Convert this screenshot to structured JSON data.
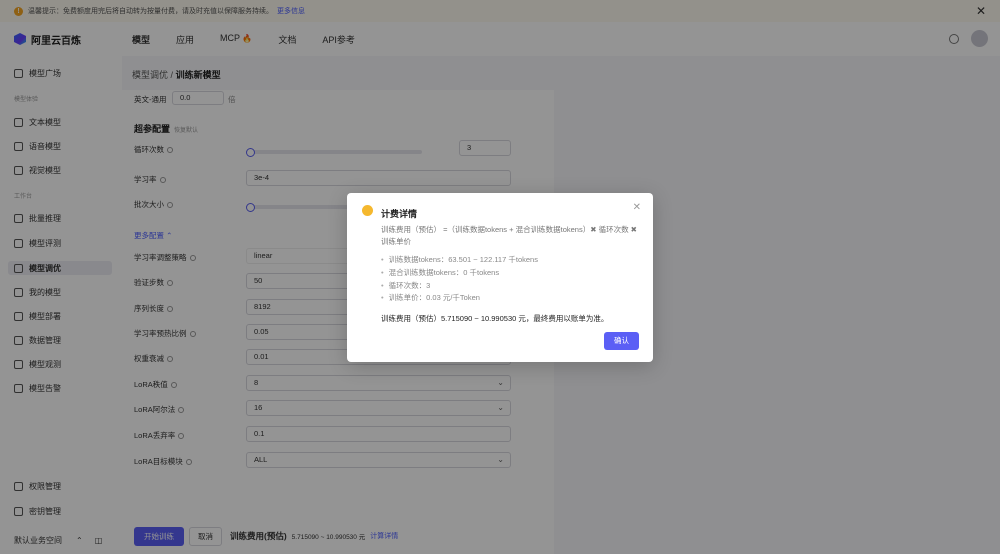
{
  "banner": {
    "text": "温馨提示：免费额度用完后将自动转为按量付费，请及时充值以保障服务持续。",
    "link": "更多信息"
  },
  "topbar": {
    "logo_text": "阿里云百炼",
    "nav": [
      {
        "label": "模型"
      },
      {
        "label": "应用"
      },
      {
        "label": "MCP"
      },
      {
        "label": "文档"
      },
      {
        "label": "API参考"
      }
    ]
  },
  "sidebar": {
    "items": [
      {
        "label": "模型广场"
      },
      {
        "label": "文本模型"
      },
      {
        "label": "语音模型"
      },
      {
        "label": "视觉模型"
      },
      {
        "label": "批量推理"
      },
      {
        "label": "模型评测"
      },
      {
        "label": "模型调优"
      },
      {
        "label": "我的模型"
      },
      {
        "label": "模型部署"
      },
      {
        "label": "数据管理"
      },
      {
        "label": "模型观测"
      },
      {
        "label": "模型告警"
      },
      {
        "label": "权限管理"
      },
      {
        "label": "密钥管理"
      },
      {
        "label": "默认业务空间"
      }
    ],
    "groups": [
      "模型体验",
      "工作台"
    ]
  },
  "breadcrumb": {
    "parent": "模型调优",
    "sep": "/",
    "current": "训练新模型"
  },
  "form": {
    "english_label": "英文-通用",
    "english_value": "0.0",
    "english_unit": "倍",
    "section_title": "超参配置",
    "reset_label": "恢复默认",
    "epochs_label": "循环次数",
    "epochs_value": "3",
    "lr_label": "学习率",
    "lr_value": "3e-4",
    "batch_label": "批次大小",
    "more_label": "更多配置",
    "scheduler_label": "学习率调整策略",
    "scheduler_value": "linear",
    "eval_steps_label": "验证步数",
    "eval_steps_value": "50",
    "seq_len_label": "序列长度",
    "seq_len_value": "8192",
    "warmup_label": "学习率预热比例",
    "warmup_value": "0.05",
    "weight_decay_label": "权重衰减",
    "weight_decay_value": "0.01",
    "lora_rank_label": "LoRA秩值",
    "lora_rank_value": "8",
    "lora_alpha_label": "LoRA阿尔法",
    "lora_alpha_value": "16",
    "lora_dropout_label": "LoRA丢弃率",
    "lora_dropout_value": "0.1",
    "lora_target_label": "LoRA目标模块",
    "lora_target_value": "ALL"
  },
  "footer": {
    "start_label": "开始训练",
    "cancel_label": "取消",
    "fee_label": "训练费用(预估)",
    "fee_value": "5.715090 ~ 10.990530 元",
    "detail_link": "计算详情"
  },
  "modal": {
    "title": "计费详情",
    "formula": "训练费用（预估） =（训练数据tokens + 混合训练数据tokens）✖ 循环次数 ✖ 训练单价",
    "items": [
      "训练数据tokens：63.501 ~ 122.117 千tokens",
      "混合训练数据tokens：0 千tokens",
      "循环次数：3",
      "训练单价：0.03 元/千Token"
    ],
    "result": "训练费用（预估）5.715090 ~ 10.990530 元，最终费用以账单为准。",
    "confirm_label": "确认"
  },
  "colors": {
    "accent": "#5b5ff5",
    "warning": "#f5b82e"
  }
}
